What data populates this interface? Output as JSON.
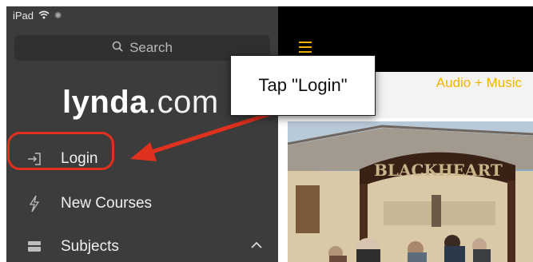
{
  "status": {
    "device": "iPad"
  },
  "search": {
    "placeholder": "Search"
  },
  "logo": {
    "bold": "lynda",
    "light": ".com"
  },
  "nav": {
    "items": [
      {
        "label": "Login",
        "icon": "login-icon"
      },
      {
        "label": "New Courses",
        "icon": "lightning-icon"
      },
      {
        "label": "Subjects",
        "icon": "stack-icon"
      }
    ]
  },
  "content": {
    "category": "Audio + Music"
  },
  "photo": {
    "sign_text": "BLACKHEART"
  },
  "callout": {
    "text": "Tap \"Login\""
  },
  "colors": {
    "accent": "#f2b300",
    "highlight": "#e0301e",
    "sidebar": "#3c3c3c"
  }
}
